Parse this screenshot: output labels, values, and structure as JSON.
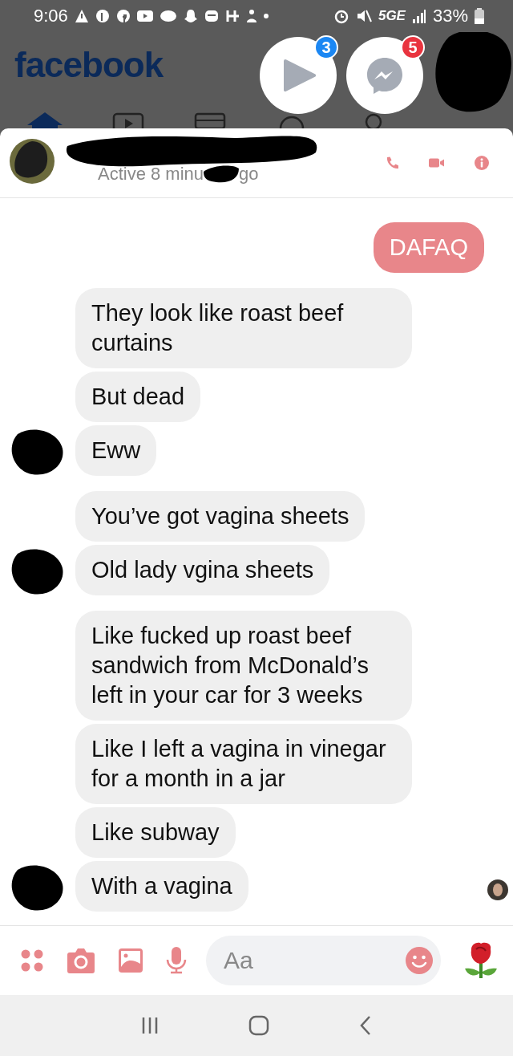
{
  "status_bar": {
    "time": "9:06",
    "network": "5GE",
    "battery": "33%"
  },
  "facebook_header": {
    "logo": "facebook"
  },
  "chat_heads": [
    {
      "kind": "video",
      "badge": "3",
      "color": "#1b87f3"
    },
    {
      "kind": "messenger",
      "badge": "5",
      "color": "#e9343f"
    },
    {
      "kind": "avatar"
    }
  ],
  "conversation": {
    "status_before": "Active 8 minu",
    "status_after": "go"
  },
  "messages": [
    {
      "kind": "sent",
      "text": "DAFAQ"
    },
    {
      "kind": "received",
      "text": "They look like roast beef curtains",
      "avatar": false
    },
    {
      "kind": "received",
      "text": "But dead",
      "avatar": false
    },
    {
      "kind": "received",
      "text": "Eww",
      "avatar": true
    },
    {
      "kind": "received",
      "text": "You’ve got vagina sheets",
      "avatar": false
    },
    {
      "kind": "received",
      "text": "Old lady vgina sheets",
      "avatar": true
    },
    {
      "kind": "received",
      "text": "Like fucked up roast beef sandwich from McDonald’s left in your car for 3 weeks",
      "avatar": false
    },
    {
      "kind": "received",
      "text": "Like I left a vagina in vinegar for a month in a jar",
      "avatar": false
    },
    {
      "kind": "received",
      "text": "Like subway",
      "avatar": false
    },
    {
      "kind": "received",
      "text": "With a vagina",
      "avatar": true
    }
  ],
  "composer": {
    "placeholder": "Aa"
  }
}
